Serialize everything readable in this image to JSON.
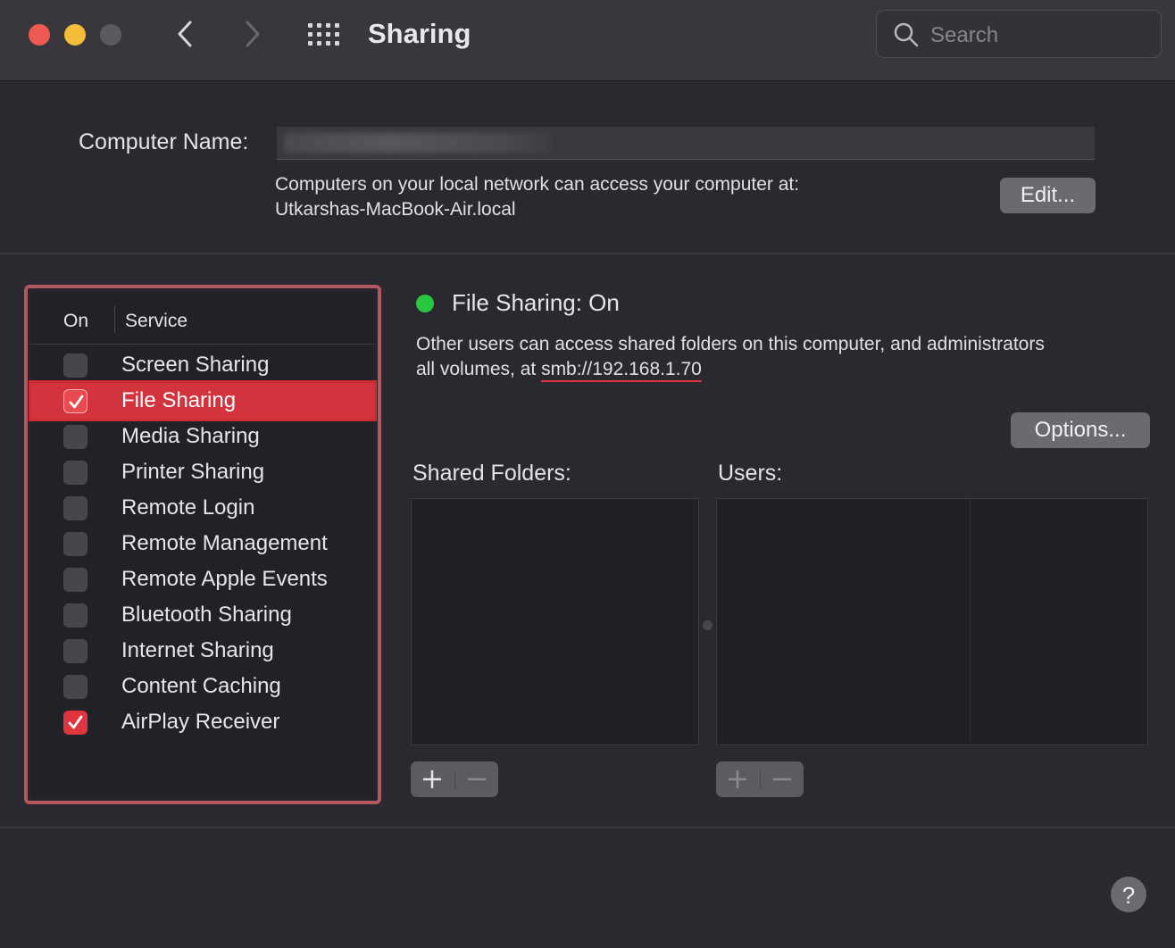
{
  "window": {
    "title": "Sharing",
    "search_placeholder": "Search"
  },
  "computer_name": {
    "label": "Computer Name:",
    "value": "",
    "network_text": "Computers on your local network can access your computer at:",
    "local_address": "Utkarshas-MacBook-Air.local",
    "edit_label": "Edit..."
  },
  "services": {
    "header_on": "On",
    "header_service": "Service",
    "items": [
      {
        "label": "Screen Sharing",
        "checked": false
      },
      {
        "label": "File Sharing",
        "checked": true
      },
      {
        "label": "Media Sharing",
        "checked": false
      },
      {
        "label": "Printer Sharing",
        "checked": false
      },
      {
        "label": "Remote Login",
        "checked": false
      },
      {
        "label": "Remote Management",
        "checked": false
      },
      {
        "label": "Remote Apple Events",
        "checked": false
      },
      {
        "label": "Bluetooth Sharing",
        "checked": false
      },
      {
        "label": "Internet Sharing",
        "checked": false
      },
      {
        "label": "Content Caching",
        "checked": false
      },
      {
        "label": "AirPlay Receiver",
        "checked": true
      }
    ],
    "selected_index": 1
  },
  "detail": {
    "status": "File Sharing: On",
    "status_color": "#29c740",
    "description_line1": "Other users can access shared folders on this computer, and administrators",
    "description_line2_prefix": "all volumes, at ",
    "smb_address": "smb://192.168.1.70",
    "options_label": "Options...",
    "shared_folders_label": "Shared Folders:",
    "users_label": "Users:"
  },
  "colors": {
    "accent_red": "#e0343e",
    "highlight_border": "#b2585e"
  }
}
